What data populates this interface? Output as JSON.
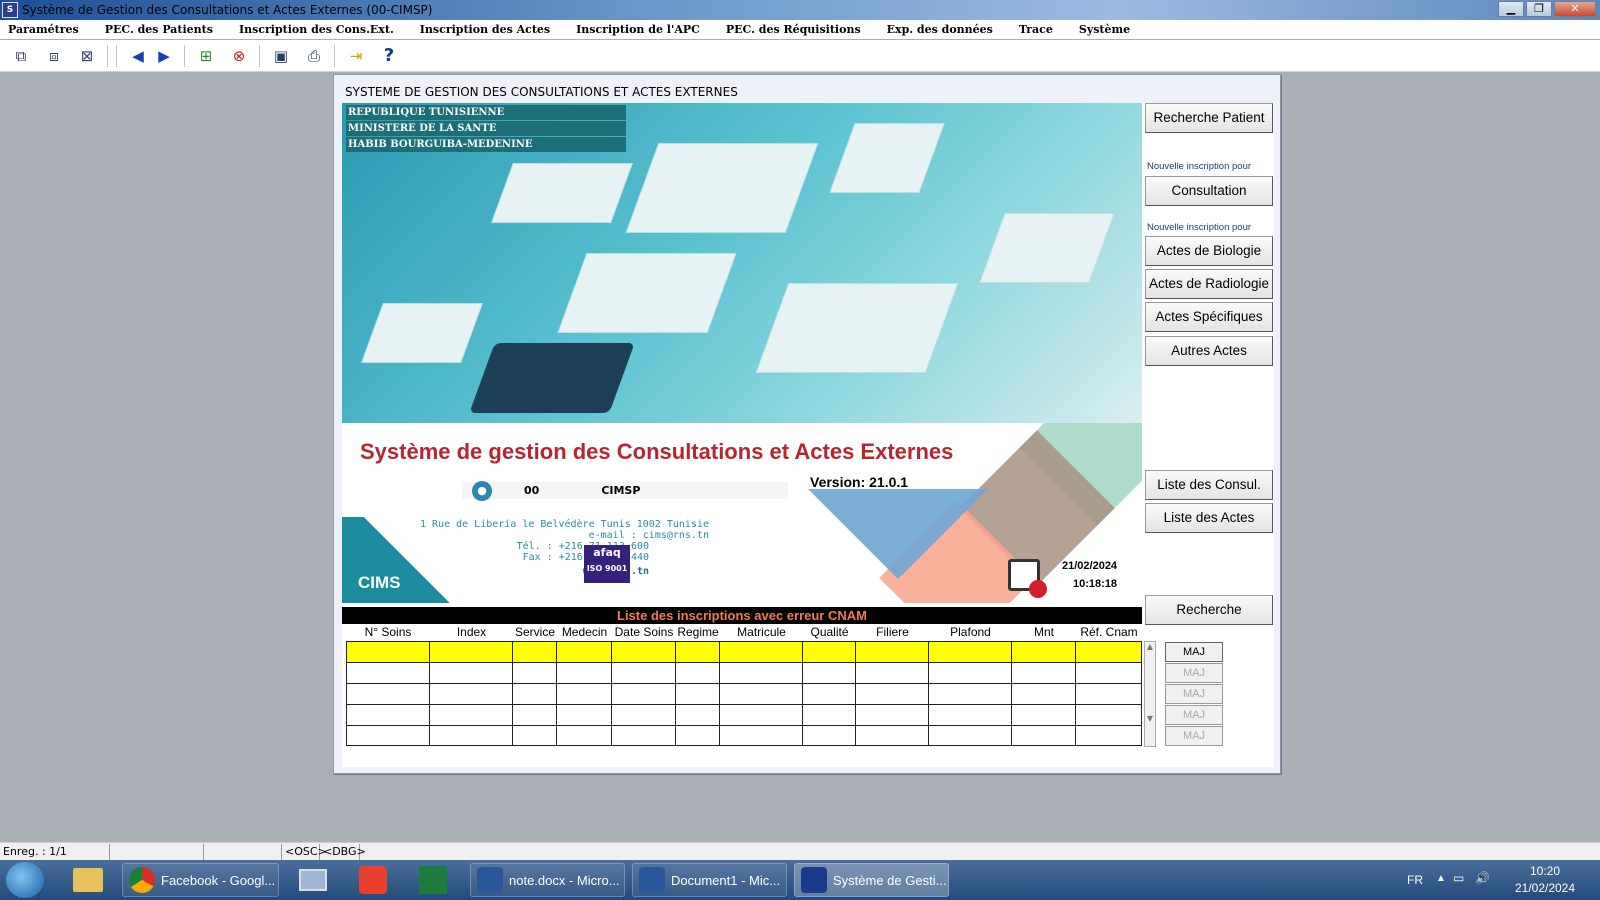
{
  "window": {
    "title": "Système de Gestion des Consultations et Actes Externes (00-CIMSP)",
    "icon": "app-icon"
  },
  "menu": [
    "Paramétres",
    "PEC. des Patients",
    "Inscription des Cons.Ext.",
    "Inscription des Actes",
    "Inscription de l'APC",
    "PEC. des Réquisitions",
    "Exp. des données",
    "Trace",
    "Système"
  ],
  "toolbar": {
    "help": "?"
  },
  "panel": {
    "title": "SYSTEME DE GESTION DES CONSULTATIONS ET ACTES EXTERNES",
    "ministry": [
      "REPUBLIQUE TUNISIENNE",
      "MINISTERE DE LA SANTE",
      "HABIB BOURGUIBA-MEDENINE"
    ],
    "app_title": "Système de gestion des Consultations et Actes Externes",
    "version_label": "Version:",
    "version": "21.0.1",
    "user_code": "00",
    "user_name": "CIMSP",
    "address": {
      "line1": "1 Rue de Liberia le Belvédère Tunis 1002",
      "country": "Tunisie",
      "email": "e-mail : cims@rns.tn",
      "tel": "Tél. : +216 71 113 600",
      "fax": "Fax : +216 71 790 440",
      "web": "www.cims.tn"
    },
    "logo_text": "CIMS",
    "afaq_text": "afaq",
    "afaq_sub": "ISO 9001",
    "date": "21/02/2024",
    "time": "10:18:18"
  },
  "buttons": {
    "recherche_patient": "Recherche Patient",
    "note1": "Nouvelle inscription pour",
    "consultation": "Consultation",
    "note2": "Nouvelle inscription pour",
    "biologie": "Actes de Biologie",
    "radiologie": "Actes de Radiologie",
    "specifiques": "Actes Spécifiques",
    "autres": "Autres Actes",
    "liste_consul": "Liste des Consul.",
    "liste_actes": "Liste des Actes",
    "recherche": "Recherche"
  },
  "grid": {
    "title": "Liste des inscriptions avec erreur CNAM",
    "columns": [
      "N° Soins",
      "Index",
      "Service",
      "Medecin",
      "Date Soins",
      "Regime",
      "Matricule",
      "Qualité Ass.",
      "Filiere",
      "Plafond",
      "Mnt",
      "Réf. Cnam"
    ],
    "row_count": 5,
    "maj_label": "MAJ"
  },
  "status": {
    "record": "Enreg. : 1/1",
    "osc": "<OSC>",
    "dbg": "<DBG>"
  },
  "taskbar": {
    "items": [
      "Facebook - Googl...",
      "note.docx - Micro...",
      "Document1 - Mic...",
      "Système de Gesti..."
    ],
    "lang": "FR",
    "time": "10:20",
    "date": "21/02/2024"
  }
}
